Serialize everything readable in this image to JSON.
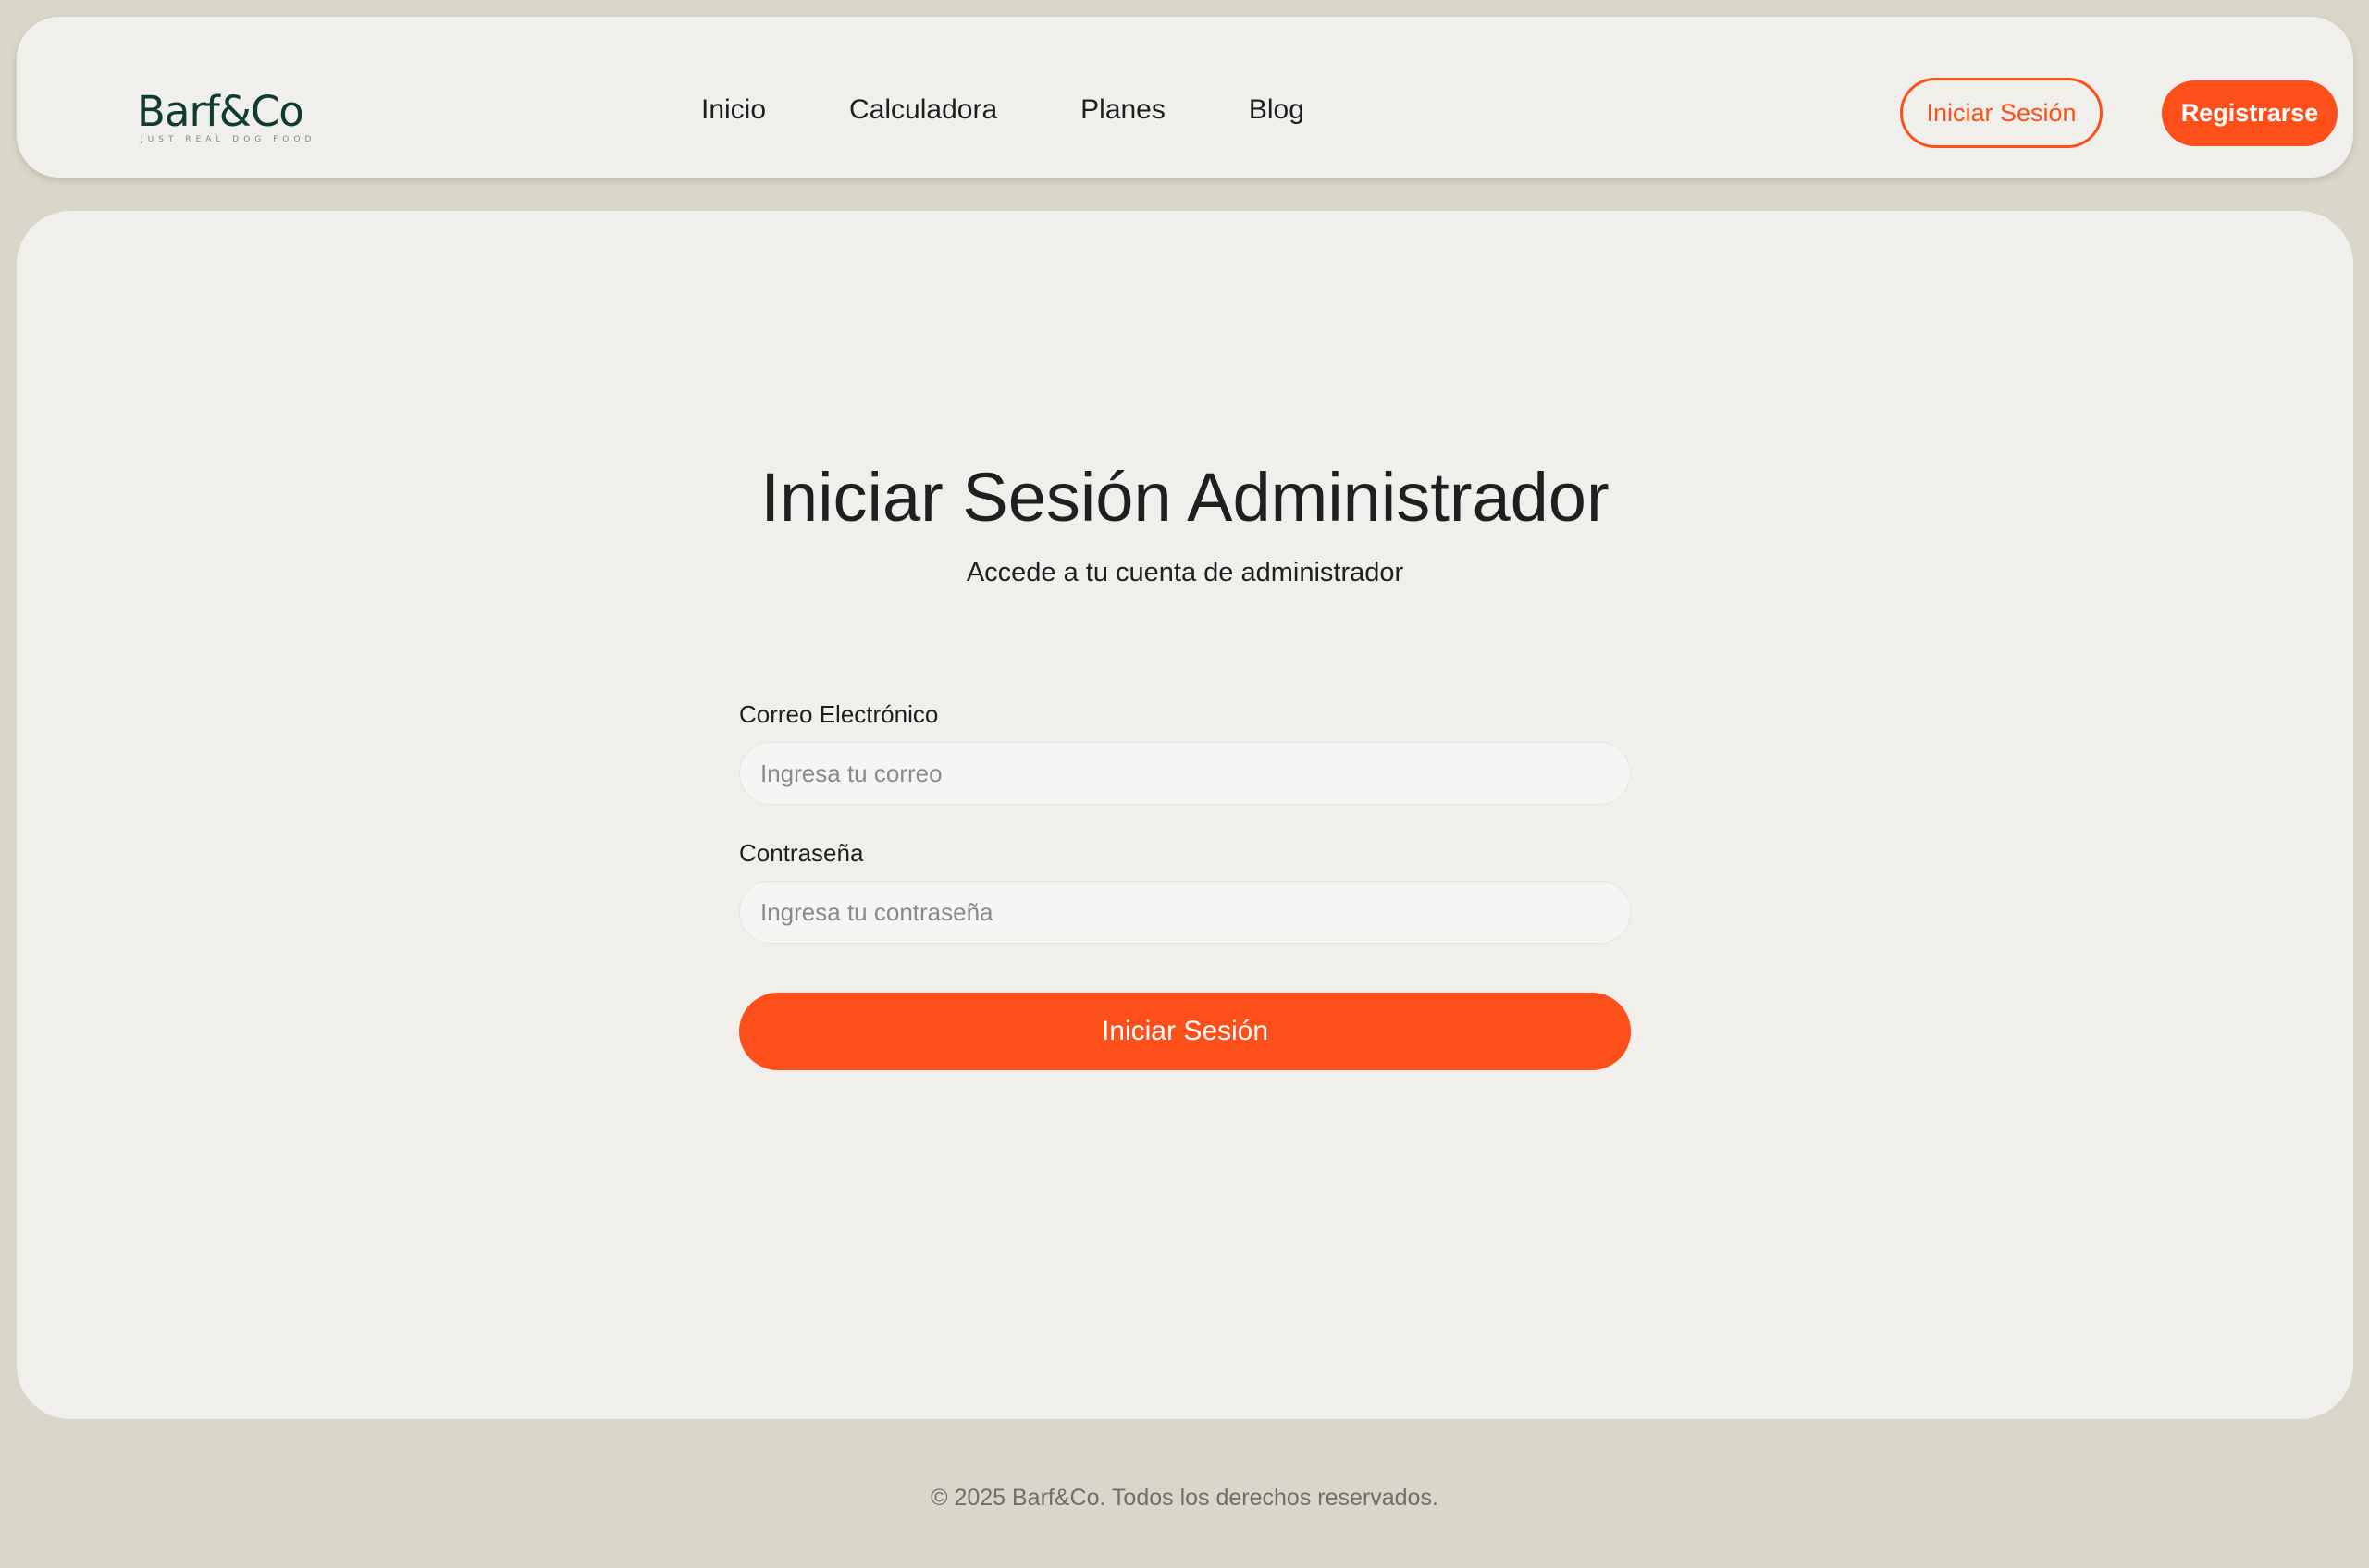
{
  "header": {
    "logo": {
      "name": "Barf&Co",
      "tagline": "JUST REAL DOG FOOD"
    },
    "nav": [
      {
        "label": "Inicio"
      },
      {
        "label": "Calculadora"
      },
      {
        "label": "Planes"
      },
      {
        "label": "Blog"
      }
    ],
    "login_label": "Iniciar Sesión",
    "register_label": "Registrarse"
  },
  "main": {
    "title": "Iniciar Sesión Administrador",
    "subtitle": "Accede a tu cuenta de administrador",
    "form": {
      "email": {
        "label": "Correo Electrónico",
        "placeholder": "Ingresa tu correo",
        "value": ""
      },
      "password": {
        "label": "Contraseña",
        "placeholder": "Ingresa tu contraseña",
        "value": ""
      },
      "submit_label": "Iniciar Sesión"
    }
  },
  "footer": {
    "text": "© 2025 Barf&Co. Todos los derechos reservados."
  },
  "colors": {
    "accent": "#fd4f1a",
    "brand": "#0f3b30",
    "background": "#d9d6ca",
    "card": "#f0efeb"
  }
}
